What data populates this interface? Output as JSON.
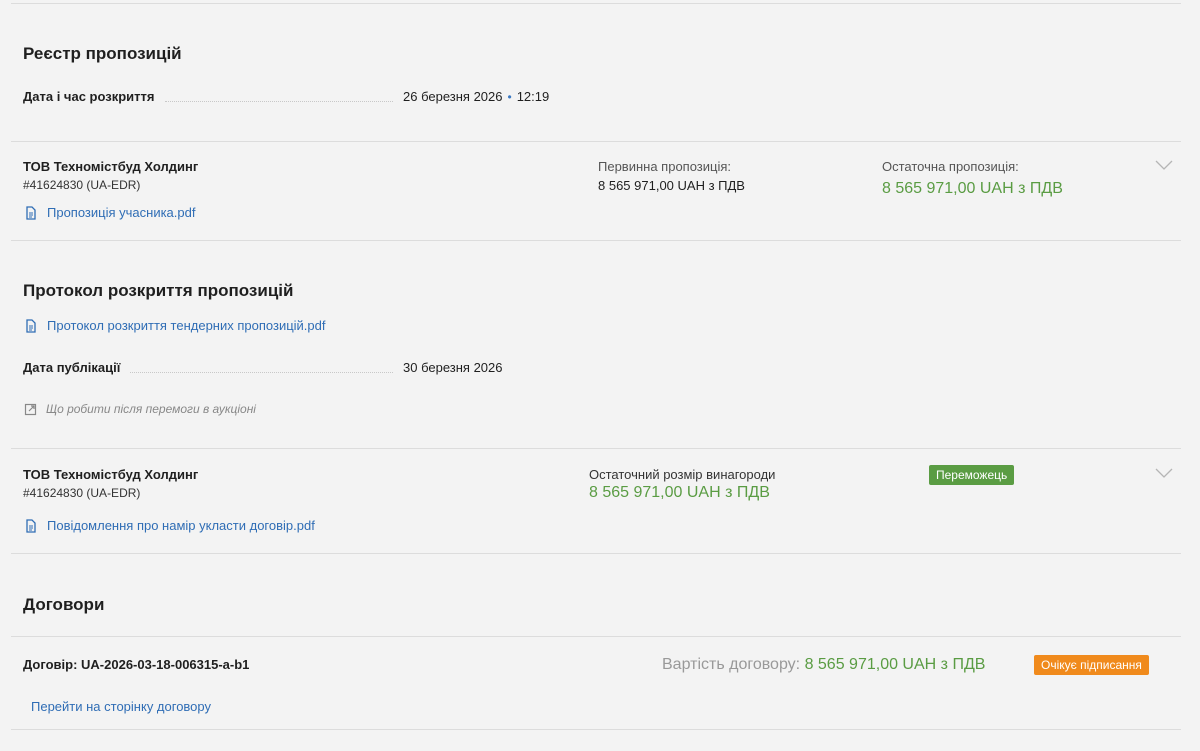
{
  "bids_section": {
    "title": "Реєстр пропозицій",
    "opening_label": "Дата і час розкриття",
    "opening_date": "26 березня 2026",
    "opening_sep": "•",
    "opening_time": "12:19"
  },
  "bid": {
    "org_name": "ТОВ Техномістбуд Холдинг",
    "org_id": "#41624830 (UA-EDR)",
    "doc_label": "Пропозиція учасника.pdf",
    "initial_label": "Первинна пропозиція:",
    "initial_value": "8 565 971,00 UAH з ПДВ",
    "final_label": "Остаточна пропозиція:",
    "final_value": "8 565 971,00 UAH з ПДВ"
  },
  "protocol_section": {
    "title": "Протокол розкриття пропозицій",
    "doc_label": "Протокол розкриття тендерних пропозицій.pdf",
    "pub_label": "Дата публікації",
    "pub_date": "30 березня 2026",
    "help_link": "Що робити після перемоги в аукціоні"
  },
  "award": {
    "org_name": "ТОВ Техномістбуд Холдинг",
    "org_id": "#41624830 (UA-EDR)",
    "doc_label": "Повідомлення про намір укласти договір.pdf",
    "amount_label": "Остаточний розмір винагороди",
    "amount_value": "8 565 971,00 UAH з ПДВ",
    "status": "Переможець"
  },
  "contracts_section": {
    "title": "Договори",
    "contract_label": "Договір: UA-2026-03-18-006315-a-b1",
    "cost_label": "Вартість договору:",
    "cost_value": "8 565 971,00 UAH з ПДВ",
    "status": "Очікує підписання",
    "go_link": "Перейти на сторінку договору"
  },
  "colors": {
    "accent_green": "#5a9c43",
    "accent_orange": "#f08a1c",
    "link_blue": "#2f6db5"
  }
}
